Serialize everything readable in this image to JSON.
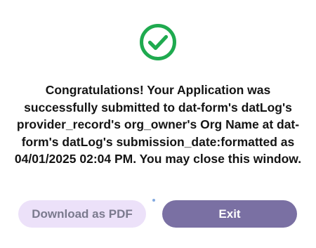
{
  "dialog": {
    "icon": "check-circle-icon",
    "message": "Congratulations! Your Application was successfully submitted to dat-form's datLog's provider_record's org_owner's Org Name at dat-form's datLog's submission_date:formatted as 04/01/2025 02:04 PM. You may close this window.",
    "buttons": {
      "download_label": "Download as PDF",
      "exit_label": "Exit"
    }
  },
  "colors": {
    "success_green": "#1faa4f",
    "pdf_button_bg": "#ece1f9",
    "pdf_button_text": "#7b7a8e",
    "exit_button_bg": "#7a70a3",
    "exit_button_text": "#ffffff"
  }
}
